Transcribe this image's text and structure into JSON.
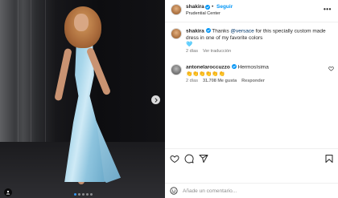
{
  "post": {
    "author": "shakira",
    "follow_label": "Seguir",
    "location": "Prudential Center",
    "more_label": "•••"
  },
  "caption": {
    "author": "shakira",
    "text_before": "Thanks ",
    "mention": "@versace",
    "text_after": " for this specially custom made dress in one of my favorite colors",
    "emoji": "🩵",
    "age": "2 días",
    "translation_label": "Ver traducción"
  },
  "comment": {
    "author": "antonelaroccuzzo",
    "text": "Hermosísima",
    "emojis": "👏👏👏👏👏👏",
    "age": "2 días",
    "likes": "31.708 Me gusta",
    "reply_label": "Responder"
  },
  "comment_box": {
    "placeholder": "Añade un comentario..."
  },
  "photo": {
    "dress_color": "#a8d6ea",
    "dots_total": 5,
    "dot_active": 0
  },
  "icons": {
    "like": "heart-icon",
    "comment": "comment-icon",
    "share": "share-icon",
    "save": "bookmark-icon",
    "next": "chevron-right-icon",
    "tag": "user-tag-icon",
    "emoji": "emoji-icon"
  },
  "colors": {
    "link": "#0095f6",
    "mention": "#00376b",
    "verified": "#0095f6",
    "muted": "#737373"
  }
}
